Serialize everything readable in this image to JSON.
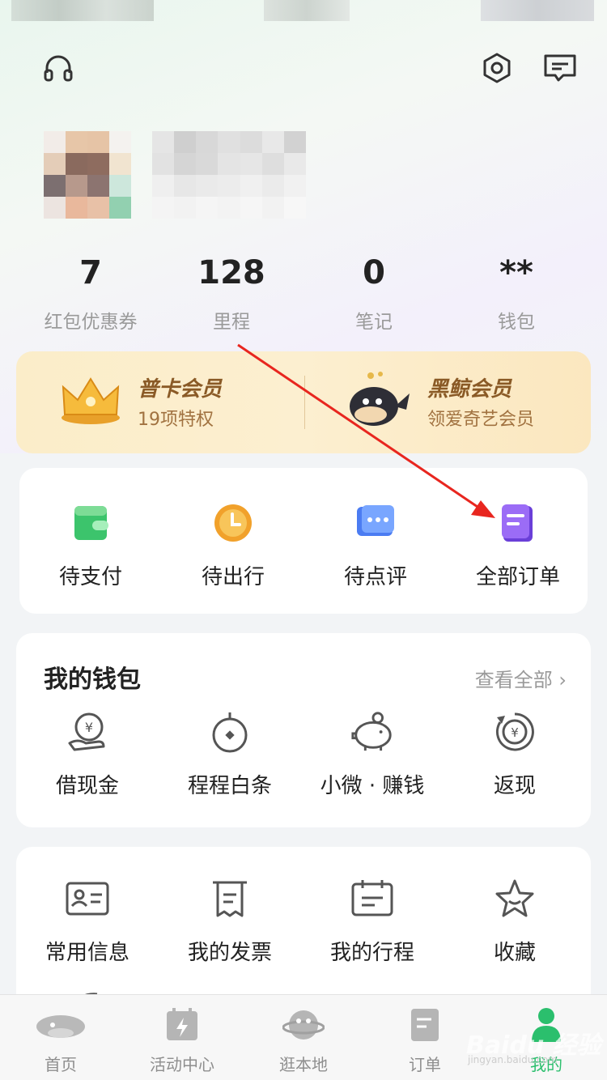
{
  "stats": [
    {
      "value": "7",
      "label": "红包优惠券"
    },
    {
      "value": "128",
      "label": "里程"
    },
    {
      "value": "0",
      "label": "笔记"
    },
    {
      "value": "**",
      "label": "钱包"
    }
  ],
  "membership": {
    "left": {
      "title": "普卡会员",
      "subtitle": "19项特权"
    },
    "right": {
      "title": "黑鲸会员",
      "subtitle": "领爱奇艺会员"
    }
  },
  "orders": [
    {
      "label": "待支付",
      "icon": "wallet-icon"
    },
    {
      "label": "待出行",
      "icon": "clock-icon"
    },
    {
      "label": "待点评",
      "icon": "chat-bubble-icon"
    },
    {
      "label": "全部订单",
      "icon": "document-icon"
    }
  ],
  "wallet": {
    "title": "我的钱包",
    "more": "查看全部 ›",
    "items": [
      {
        "label": "借现金",
        "icon": "yuan-hand-icon"
      },
      {
        "label": "程程白条",
        "icon": "compass-icon"
      },
      {
        "label": "小微 · 赚钱",
        "icon": "piggy-bank-icon"
      },
      {
        "label": "返现",
        "icon": "cashback-icon"
      }
    ]
  },
  "services": [
    {
      "label": "常用信息",
      "icon": "id-card-icon"
    },
    {
      "label": "我的发票",
      "icon": "invoice-icon"
    },
    {
      "label": "我的行程",
      "icon": "calendar-icon"
    },
    {
      "label": "收藏",
      "icon": "star-icon"
    }
  ],
  "tabs": [
    {
      "label": "首页",
      "icon": "home-whale-icon"
    },
    {
      "label": "活动中心",
      "icon": "activity-icon"
    },
    {
      "label": "逛本地",
      "icon": "planet-icon"
    },
    {
      "label": "订单",
      "icon": "order-icon"
    },
    {
      "label": "我的",
      "icon": "profile-icon",
      "active": true
    }
  ],
  "watermark": {
    "text": "Baidu 经验",
    "sub": "jingyan.baidu.com"
  },
  "colors": {
    "accent": "#2bbf6d",
    "arrow": "#e8261f",
    "gold": "#8a5a26"
  }
}
